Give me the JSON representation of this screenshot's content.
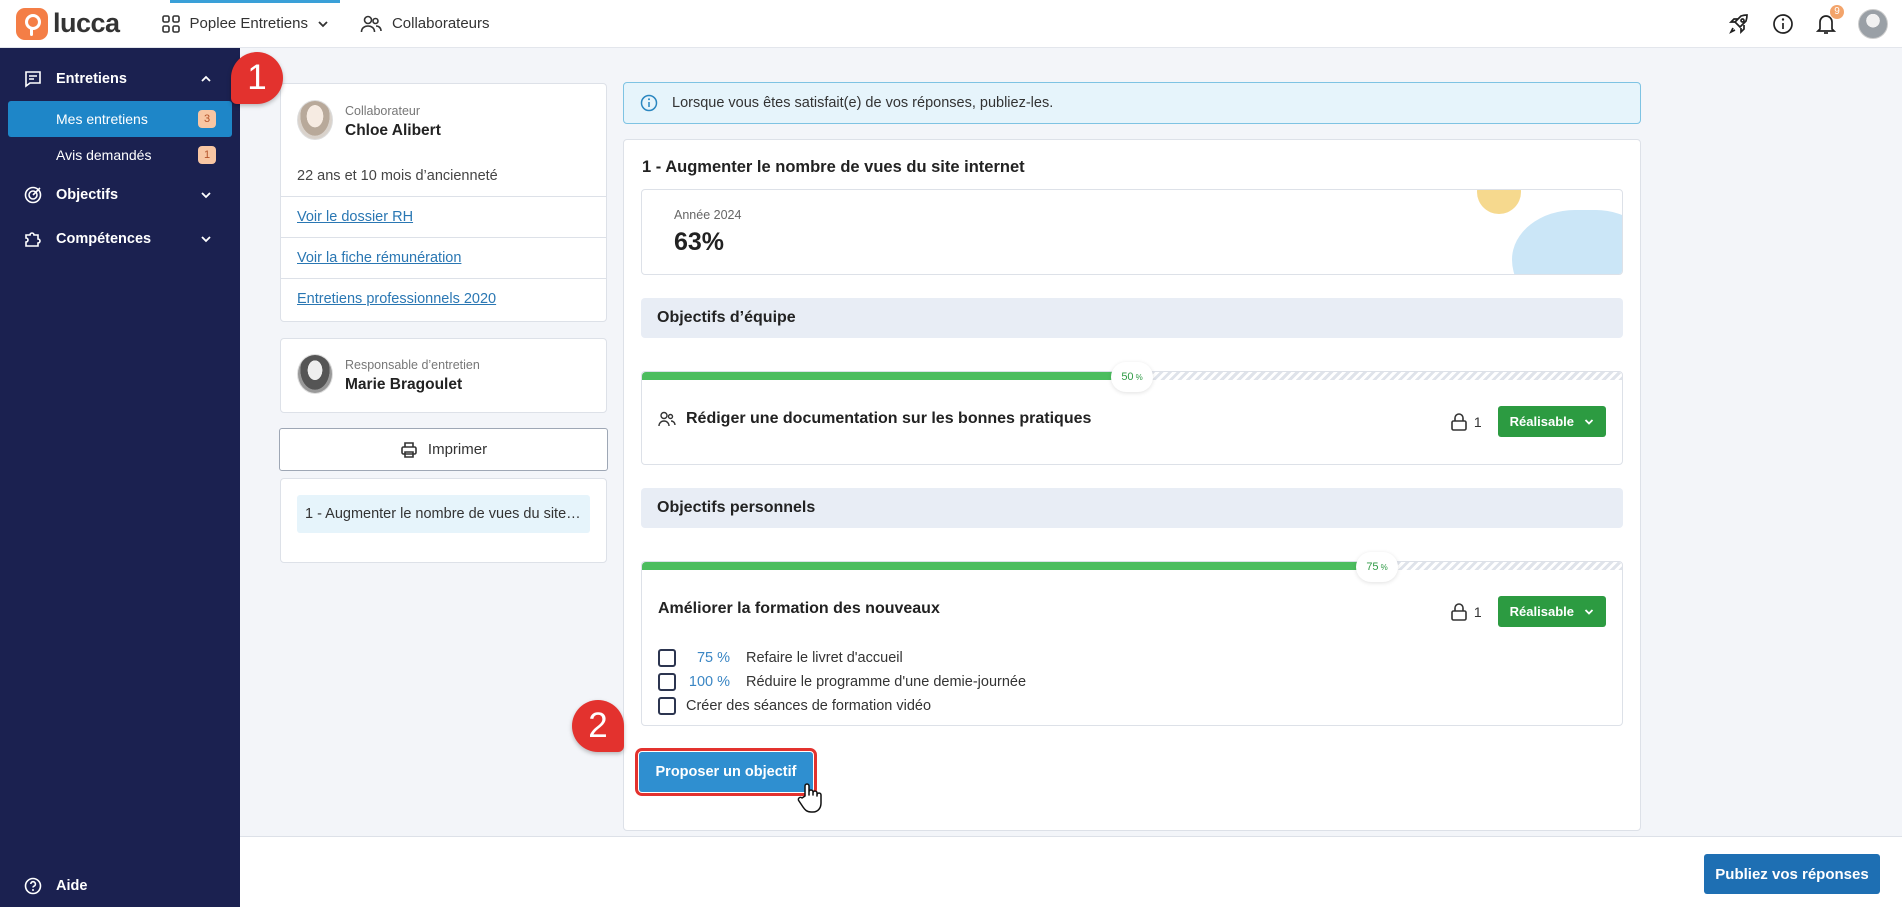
{
  "topbar": {
    "logo": "lucca",
    "app_name": "Poplee Entretiens",
    "collab_label": "Collaborateurs",
    "notif_count": "9"
  },
  "sidebar": {
    "section_entretiens": "Entretiens",
    "items": [
      {
        "label": "Mes entretiens",
        "count": "3"
      },
      {
        "label": "Avis demandés",
        "count": "1"
      }
    ],
    "section_objectifs": "Objectifs",
    "section_competences": "Compétences",
    "aide": "Aide"
  },
  "markers": {
    "one": "1",
    "two": "2"
  },
  "collaborator": {
    "role": "Collaborateur",
    "name": "Chloe Alibert",
    "seniority": "22 ans et 10 mois d’ancienneté",
    "links": [
      "Voir le dossier RH",
      "Voir la fiche rémunération",
      "Entretiens professionnels 2020"
    ]
  },
  "manager": {
    "role": "Responsable d’entretien",
    "name": "Marie Bragoulet"
  },
  "print_label": "Imprimer",
  "toc_item": "1 - Augmenter le nombre de vues du site internet",
  "info_text": "Lorsque vous êtes satisfait(e) de vos réponses, publiez-les.",
  "objective": {
    "title": "1 - Augmenter le nombre de vues du site internet",
    "year_label": "Année 2024",
    "year_value": "63%"
  },
  "team": {
    "header": "Objectifs d’équipe",
    "progress": 50,
    "progress_label": "50",
    "goal": "Rédiger une documentation sur les bonnes pratiques",
    "lock_count": "1",
    "status": "Réalisable"
  },
  "personal": {
    "header": "Objectifs personnels",
    "progress": 75,
    "progress_label": "75",
    "goal": "Améliorer la formation des nouveaux",
    "lock_count": "1",
    "status": "Réalisable",
    "subs": [
      {
        "pct": "75 %",
        "label": "Refaire le livret d'accueil"
      },
      {
        "pct": "100 %",
        "label": "Réduire le programme d'une demie-journée"
      },
      {
        "pct": "",
        "label": "Créer des séances de formation vidéo"
      }
    ]
  },
  "percent_sign": "%",
  "propose_label": "Proposer un objectif",
  "publish_label": "Publiez vos réponses",
  "colors": {
    "sidebar": "#1b2150",
    "accent": "#1e86c8",
    "success": "#2c9b41",
    "marker": "#e3322e"
  }
}
